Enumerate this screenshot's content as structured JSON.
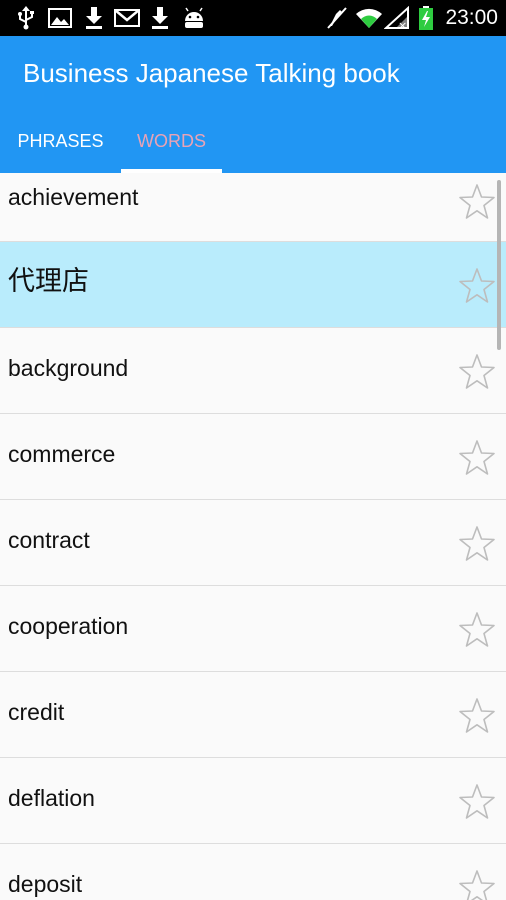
{
  "status_bar": {
    "icons": [
      "usb-icon",
      "image-icon",
      "download-icon",
      "gmail-icon",
      "download-icon",
      "android-icon",
      "mute-icon",
      "wifi-icon",
      "no-signal-icon",
      "battery-icon"
    ],
    "time": "23:00"
  },
  "app_bar": {
    "title": "Business Japanese Talking book"
  },
  "tabs": [
    {
      "label": "PHRASES",
      "active": false
    },
    {
      "label": "WORDS",
      "active": true
    }
  ],
  "colors": {
    "app_bar": "#2196f3",
    "selected_row": "#b9ecfc",
    "active_tab_text": "#e8a3b6"
  },
  "words": [
    {
      "label": "achievement",
      "selected": false
    },
    {
      "label": "代理店",
      "selected": true
    },
    {
      "label": "background",
      "selected": false
    },
    {
      "label": "commerce",
      "selected": false
    },
    {
      "label": "contract",
      "selected": false
    },
    {
      "label": "cooperation",
      "selected": false
    },
    {
      "label": "credit",
      "selected": false
    },
    {
      "label": "deflation",
      "selected": false
    },
    {
      "label": "deposit",
      "selected": false
    }
  ]
}
